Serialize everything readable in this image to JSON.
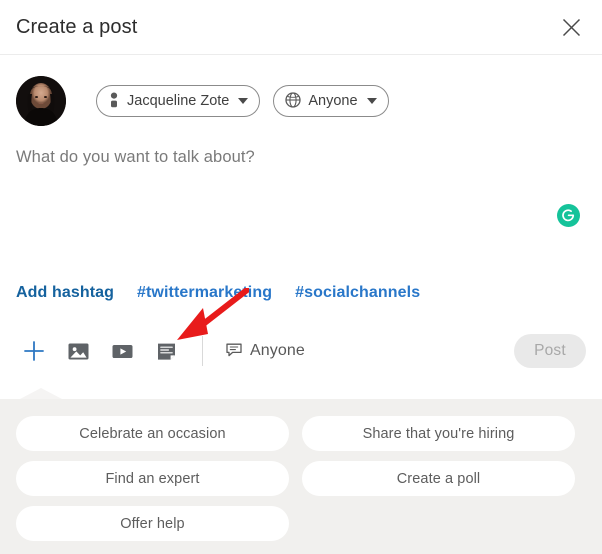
{
  "header": {
    "title": "Create a post",
    "close_icon": "close-icon"
  },
  "identity": {
    "avatar_alt": "Jacqueline Zote profile photo",
    "author_name": "Jacqueline Zote",
    "author_icon": "person-icon",
    "visibility": "Anyone",
    "visibility_icon": "globe-icon",
    "caret_icon": "chevron-down-icon"
  },
  "editor": {
    "placeholder": "What do you want to talk about?",
    "value": "",
    "assistant_icon": "grammarly-icon"
  },
  "hashtags": {
    "add_label": "Add hashtag",
    "items": [
      "#twittermarketing",
      "#socialchannels"
    ]
  },
  "toolbar": {
    "add_label": "+",
    "add_icon": "plus-icon",
    "image_icon": "image-icon",
    "video_icon": "video-icon",
    "document_icon": "document-icon",
    "comment_control_label": "Anyone",
    "comment_control_icon": "comment-bubble-icon",
    "post_label": "Post",
    "post_enabled": false
  },
  "annotation": {
    "arrow_color": "#e81b1b",
    "points_to": "document-icon"
  },
  "suggestions": {
    "items": [
      "Celebrate an occasion",
      "Share that you're hiring",
      "Find an expert",
      "Create a poll",
      "Offer help"
    ]
  },
  "colors": {
    "accent_blue": "#0a66c2",
    "hashtag_blue": "#2977c9",
    "hashtag_add_blue": "#15629e",
    "panel_bg": "#f1f0ee",
    "post_disabled_bg": "#e9e9e9",
    "grammarly_green": "#15c39a",
    "annotation_red": "#e81b1b"
  }
}
